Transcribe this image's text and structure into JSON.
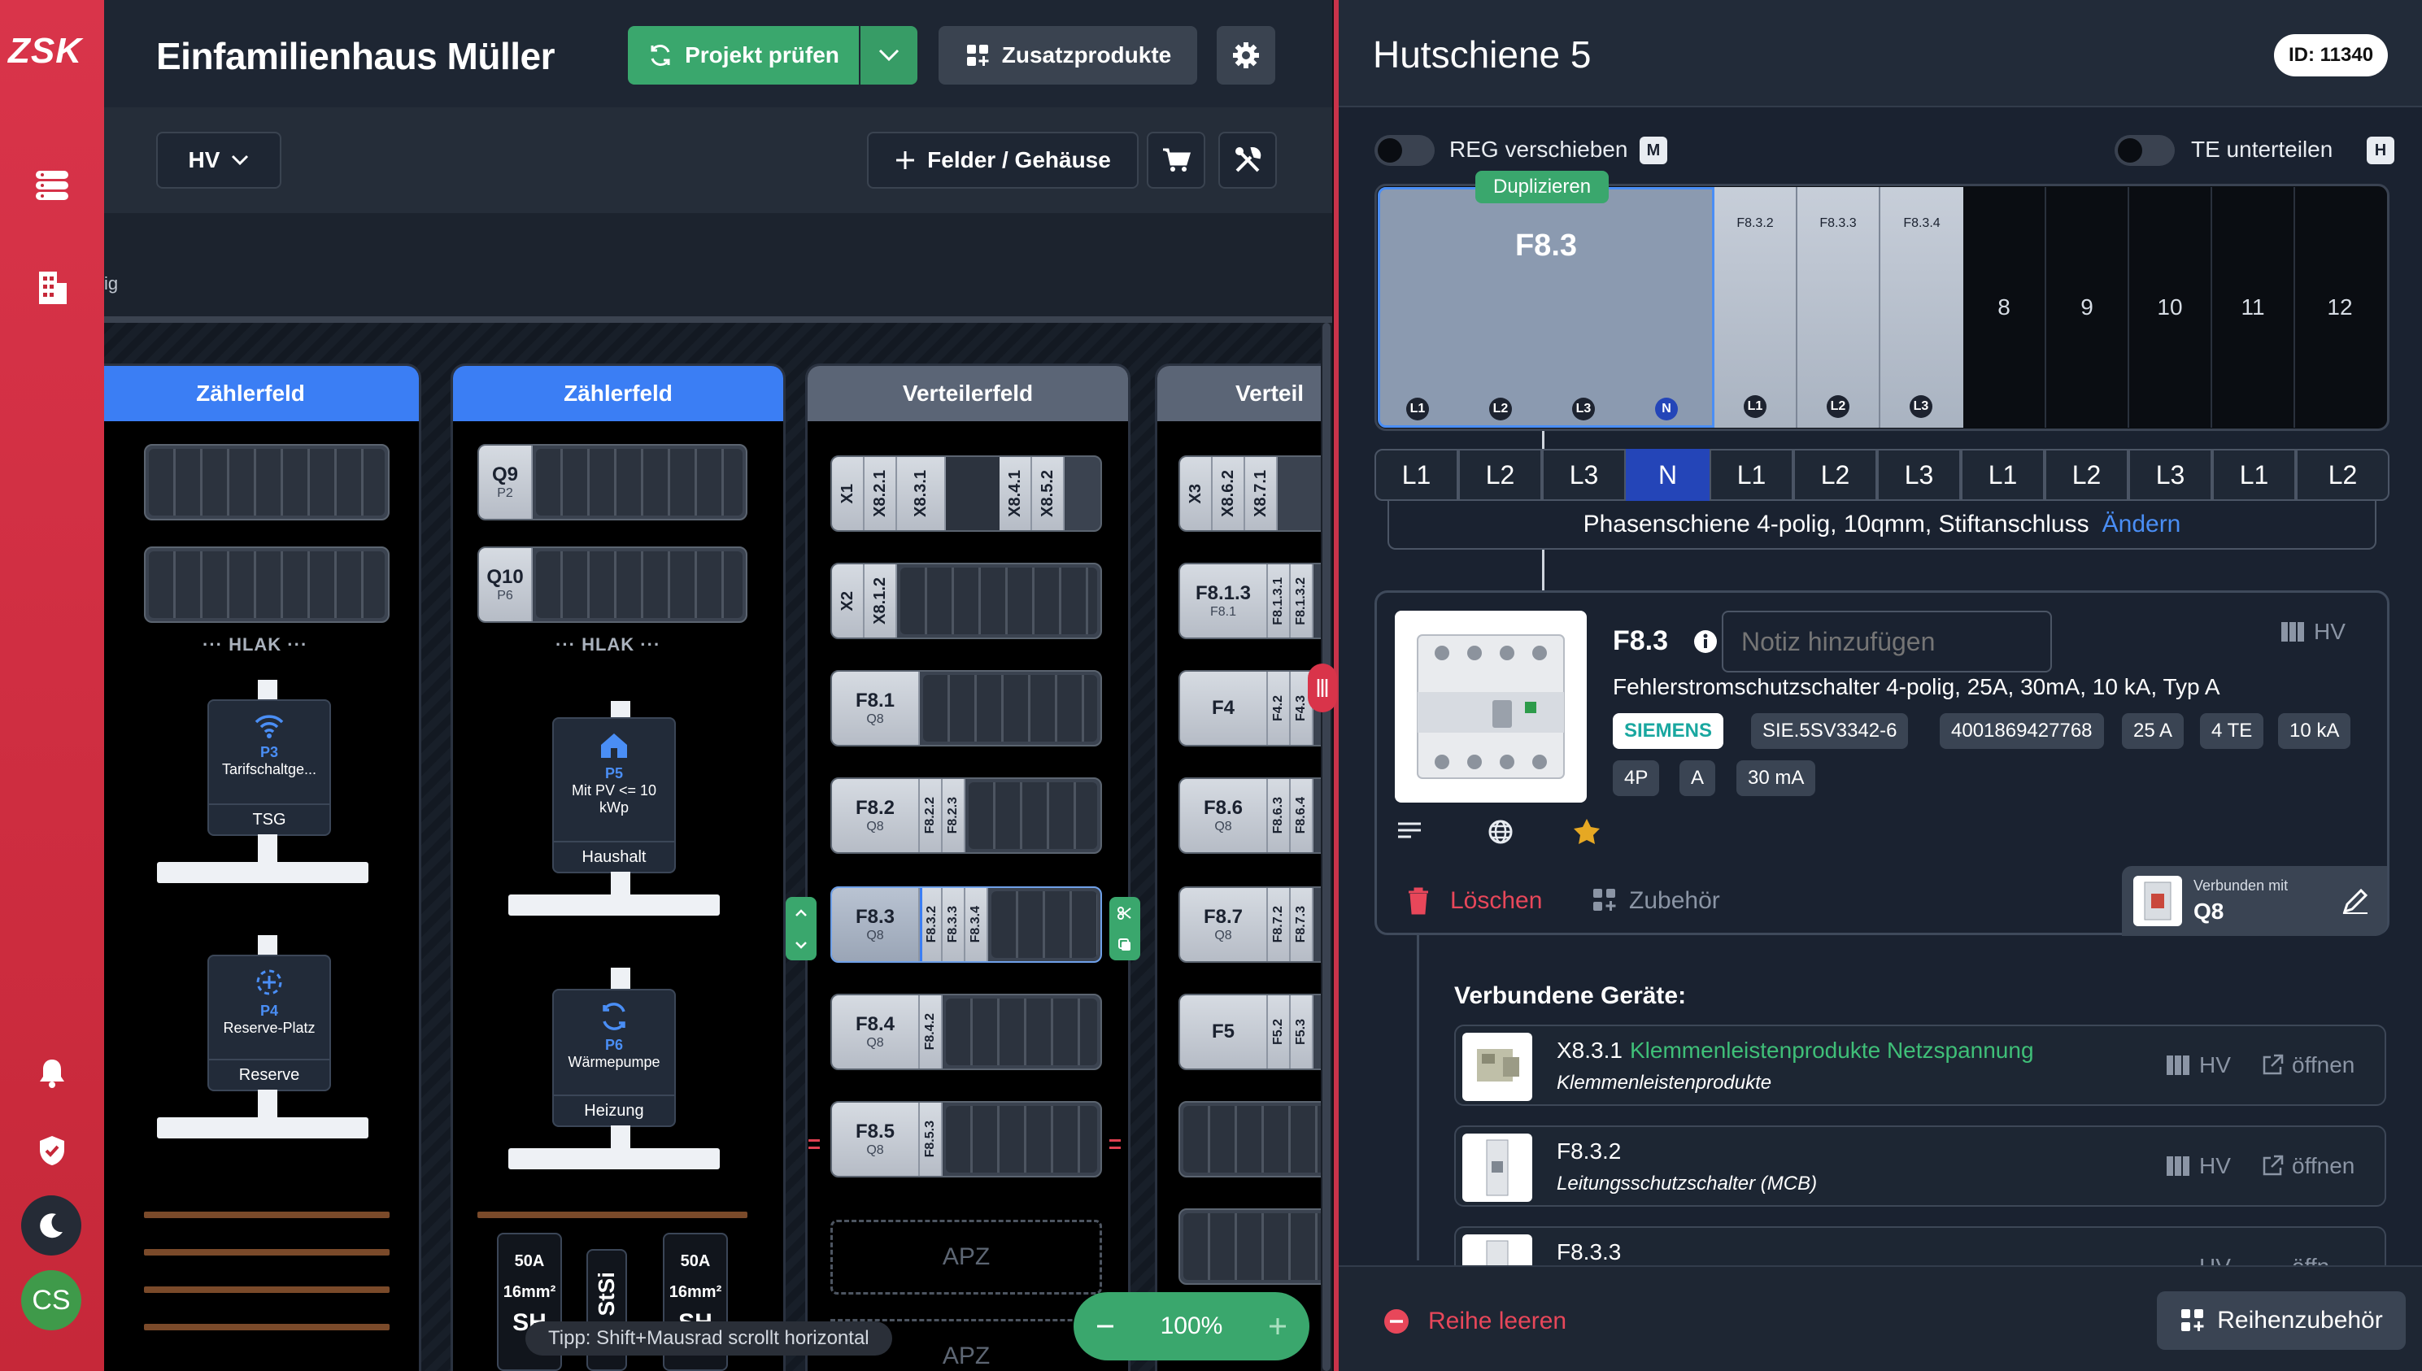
{
  "sidebar": {
    "logo": "ZSK",
    "avatar": "CS"
  },
  "header": {
    "project_title": "Einfamilienhaus Müller",
    "check_button": "Projekt prüfen",
    "extras_button": "Zusatzprodukte"
  },
  "toolbar": {
    "distributor_select": "HV",
    "fields_button": "Felder / Gehäuse"
  },
  "strip": {
    "text": "ig"
  },
  "canvas": {
    "fields": [
      {
        "title": "Zählerfeld"
      },
      {
        "title": "Zählerfeld"
      },
      {
        "title": "Verteilerfeld"
      },
      {
        "title": "Verteil"
      }
    ],
    "hlak": "··· HLAK ···",
    "field1": {
      "card_top": {
        "id": "P3",
        "label": "Tarifschaltge...",
        "footer": "TSG"
      },
      "card_bottom": {
        "id": "P4",
        "label": "Reserve-Platz",
        "footer": "Reserve"
      }
    },
    "field2": {
      "rail1": {
        "name": "Q9",
        "sub": "P2"
      },
      "rail2": {
        "name": "Q10",
        "sub": "P6"
      },
      "card_top": {
        "id": "P5",
        "label": "Mit PV <= 10 kWp",
        "footer": "Haushalt"
      },
      "card_bottom": {
        "id": "P6",
        "label": "Wärmepumpe",
        "footer": "Heizung"
      },
      "fuse1": {
        "amp": "50A",
        "mm": "16mm²",
        "cut": "SH"
      },
      "stsi": "StSi",
      "fuse2": {
        "amp": "50A",
        "mm": "16mm²",
        "cut": "SH"
      }
    },
    "field3": {
      "r1": [
        "X1",
        "X8.2.1",
        "X8.3.1",
        "X8.4.1",
        "X8.5.2"
      ],
      "r2": [
        "X2",
        "X8.1.2"
      ],
      "r3": {
        "name": "F8.1",
        "sub": "Q8"
      },
      "r4": {
        "name": "F8.2",
        "sub": "Q8",
        "mods": [
          "F8.2.2",
          "F8.2.3"
        ]
      },
      "r5": {
        "name": "F8.3",
        "sub": "Q8",
        "mods": [
          "F8.3.2",
          "F8.3.3",
          "F8.3.4"
        ]
      },
      "r6": {
        "name": "F8.4",
        "sub": "Q8",
        "mods": [
          "F8.4.2"
        ]
      },
      "r7": {
        "name": "F8.5",
        "sub": "Q8",
        "mods": [
          "F8.5.3"
        ]
      },
      "apz": "APZ",
      "apz2": "APZ"
    },
    "field4": {
      "r1": [
        "X3",
        "X8.6.2",
        "X8.7.1"
      ],
      "r2": {
        "name": "F8.1.3",
        "sub": "F8.1",
        "mods": [
          "F8.1.3.1",
          "F8.1.3.2"
        ]
      },
      "r3": {
        "name": "F4",
        "mods": [
          "F4.2",
          "F4.3"
        ]
      },
      "r4": {
        "name": "F8.6",
        "sub": "Q8",
        "mods": [
          "F8.6.3",
          "F8.6.4"
        ]
      },
      "r5": {
        "name": "F8.7",
        "sub": "Q8",
        "mods": [
          "F8.7.2",
          "F8.7.3"
        ]
      },
      "r6": {
        "name": "F5",
        "mods": [
          "F5.2",
          "F5.3"
        ]
      }
    },
    "tip": "Tipp: Shift+Mausrad scrollt horizontal",
    "zoom": "100%"
  },
  "panel": {
    "title": "Hutschiene 5",
    "id_badge": "ID: 11340",
    "reg_toggle": "REG verschieben",
    "reg_key": "M",
    "te_toggle": "TE unterteilen",
    "te_key": "H",
    "duplicate": "Duplizieren",
    "big_module": "F8.3",
    "big_terms": [
      "L1",
      "L2",
      "L3",
      "N"
    ],
    "small_modules": [
      {
        "name": "F8.3.2",
        "term": "L1"
      },
      {
        "name": "F8.3.3",
        "term": "L2"
      },
      {
        "name": "F8.3.4",
        "term": "L3"
      }
    ],
    "empty_slots": [
      "8",
      "9",
      "10",
      "11",
      "12"
    ],
    "phases": [
      "L1",
      "L2",
      "L3",
      "N",
      "L1",
      "L2",
      "L3",
      "L1",
      "L2",
      "L3",
      "L1",
      "L2"
    ],
    "busbar_text": "Phasenschiene 4-polig, 10qmm, Stiftanschluss",
    "busbar_change": "Ändern",
    "device": {
      "name": "F8.3",
      "note_placeholder": "Notiz hinzufügen",
      "location": "HV",
      "description": "Fehlerstromschutzschalter 4-polig, 25A, 30mA, 10 kA, Typ A",
      "brand": "SIEMENS",
      "chips": [
        "SIE.5SV3342-6",
        "4001869427768",
        "25 A",
        "4 TE",
        "10 kA"
      ],
      "chips2": [
        "4P",
        "A",
        "30 mA"
      ],
      "delete": "Löschen",
      "accessory": "Zubehör",
      "connected_label": "Verbunden mit",
      "connected_value": "Q8"
    },
    "connected_title": "Verbundene Geräte:",
    "connected": [
      {
        "id": "X8.3.1",
        "title": "Klemmenleistenprodukte Netzspannung",
        "sub": "Klemmenleistenprodukte",
        "loc": "HV",
        "open": "öffnen"
      },
      {
        "id": "F8.3.2",
        "title": "",
        "sub": "Leitungsschutzschalter (MCB)",
        "loc": "HV",
        "open": "öffnen"
      },
      {
        "id": "F8.3.3",
        "title": "",
        "sub": "",
        "loc": "HV",
        "open": "öffn"
      }
    ],
    "clear_row": "Reihe leeren",
    "row_accessory": "Reihenzubehör"
  },
  "colors": {
    "brand_red": "#d9344a",
    "accent_green": "#3aa76d",
    "accent_blue": "#3b7ef4",
    "link_blue": "#4a8ef5",
    "siemens_teal": "#19a7a0"
  }
}
